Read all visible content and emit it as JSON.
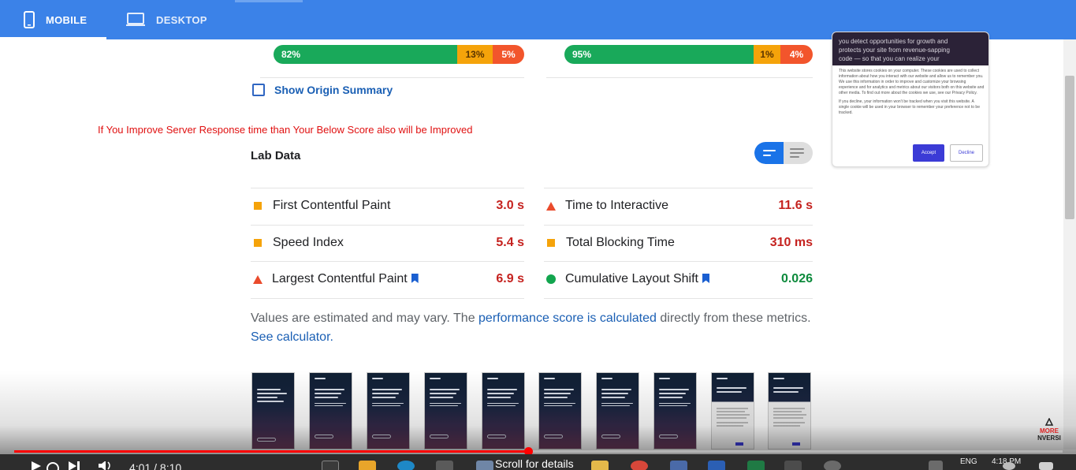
{
  "tabs": {
    "mobile": "MOBILE",
    "desktop": "DESKTOP"
  },
  "field_data": {
    "left_bar": {
      "good": "82%",
      "needs_improvement": "13%",
      "poor": "5%"
    },
    "right_bar": {
      "good": "95%",
      "needs_improvement": "1%",
      "poor": "4%"
    },
    "show_origin_summary": "Show Origin Summary"
  },
  "annotation": "If You Improve Server Response time than Your Below Score also will be Improved",
  "lab_data": {
    "title": "Lab Data",
    "metrics": [
      {
        "name": "First Contentful Paint",
        "value": "3.0 s",
        "status": "average",
        "color": "#f5a30a",
        "value_color": "#c5221f"
      },
      {
        "name": "Time to Interactive",
        "value": "11.6 s",
        "status": "poor",
        "color": "#ea4b2c",
        "value_color": "#c5221f"
      },
      {
        "name": "Speed Index",
        "value": "5.4 s",
        "status": "average",
        "color": "#f5a30a",
        "value_color": "#c5221f"
      },
      {
        "name": "Total Blocking Time",
        "value": "310 ms",
        "status": "average",
        "color": "#f5a30a",
        "value_color": "#c5221f"
      },
      {
        "name": "Largest Contentful Paint",
        "value": "6.9 s",
        "status": "poor",
        "color": "#ea4b2c",
        "value_color": "#c5221f"
      },
      {
        "name": "Cumulative Layout Shift",
        "value": "0.026",
        "status": "good",
        "color": "#12a54e",
        "value_color": "#0d8a3c"
      }
    ],
    "note_prefix": "Values are estimated and may vary. The ",
    "note_link1": "performance score is calculated",
    "note_middle": " directly from these metrics. ",
    "note_link2": "See calculator."
  },
  "cookie": {
    "header_lines": [
      "you detect opportunities for growth and",
      "protects your site from revenue-sapping",
      "code — so that you can realize your"
    ],
    "body": "This website stores cookies on your computer. These cookies are used to collect information about how you interact with our website and allow us to remember you. We use this information in order to improve and customize your browsing experience and for analytics and metrics about our visitors both on this website and other media. To find out more about the cookies we use, see our Privacy Policy.",
    "body2": "If you decline, your information won't be tracked when you visit this website. A single cookie will be used in your browser to remember your preference not to be tracked.",
    "accept": "Accept",
    "decline": "Decline"
  },
  "player": {
    "time": "4:01 / 8:10",
    "progress": 0.49,
    "scroll_hint": "Scroll for details",
    "lang": "ENG",
    "clock": "4:18 PM"
  },
  "logo": {
    "line1": "MORE",
    "line2": "NVERSI"
  }
}
